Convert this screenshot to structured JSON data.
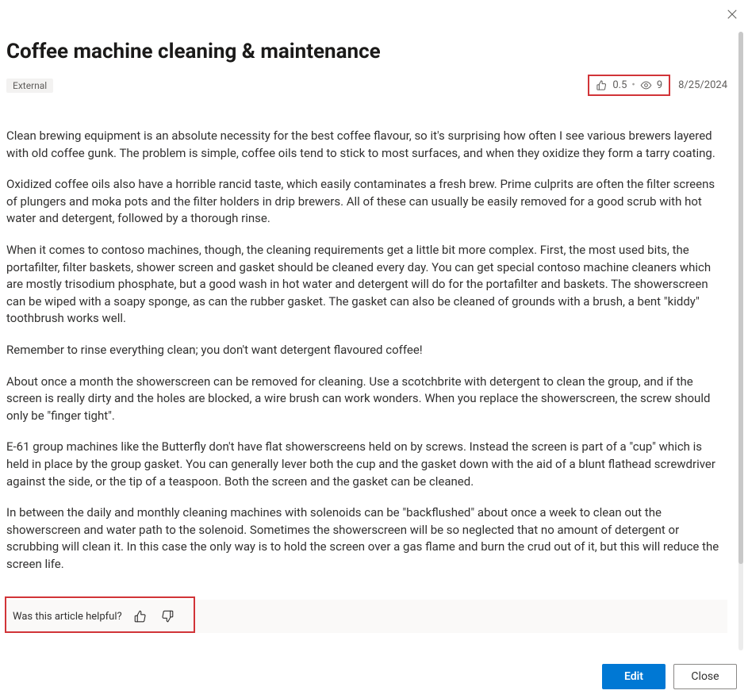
{
  "title": "Coffee machine cleaning & maintenance",
  "badge": "External",
  "stats": {
    "rating": "0.5",
    "views": "9"
  },
  "date": "8/25/2024",
  "paragraphs": [
    "Clean brewing equipment is an absolute necessity for the best coffee flavour, so it's surprising how often I see various brewers layered with old coffee gunk. The problem is simple, coffee oils tend to stick to most surfaces, and when they oxidize they form a tarry coating.",
    "Oxidized coffee oils also have a horrible rancid taste, which easily contaminates a fresh brew. Prime culprits are often the filter screens of plungers and moka pots and the filter holders in drip brewers. All of these can usually be easily removed for a good scrub with hot water and detergent, followed by a thorough rinse.",
    "When it comes to contoso machines, though, the cleaning requirements get a little bit more complex. First, the most used bits, the portafilter, filter baskets, shower screen and gasket should be cleaned every day. You can get special contoso machine cleaners which are mostly trisodium phosphate, but a good wash in hot water and detergent will do for the portafilter and baskets. The showerscreen can be wiped with a soapy sponge, as can the rubber gasket. The gasket can also be cleaned of grounds with a brush, a bent \"kiddy\" toothbrush works well.",
    "Remember to rinse everything clean; you don't want detergent flavoured coffee!",
    "About once a month the showerscreen can be removed for cleaning. Use a scotchbrite with detergent to clean the group, and if the screen is really dirty and the holes are blocked, a wire brush can work wonders. When you replace the showerscreen, the screw should only be \"finger tight\".",
    "E-61 group machines like the Butterfly don't have flat showerscreens held on by screws. Instead the screen is part of a \"cup\" which is held in place by the group gasket. You can generally lever both the cup and the gasket down with the aid of a blunt flathead screwdriver against the side, or the tip of a teaspoon. Both the screen and the gasket can be cleaned.",
    "In between the daily and monthly cleaning machines with solenoids can be \"backflushed\" about once a week to clean out the showerscreen and water path to the solenoid. Sometimes the showerscreen will be so neglected that no amount of detergent or scrubbing will clean it. In this case the only way is to hold the screen over a gas flame and burn the crud out of it, but this will reduce the screen life."
  ],
  "helpful": {
    "prompt": "Was this article helpful?"
  },
  "buttons": {
    "edit": "Edit",
    "close": "Close"
  }
}
